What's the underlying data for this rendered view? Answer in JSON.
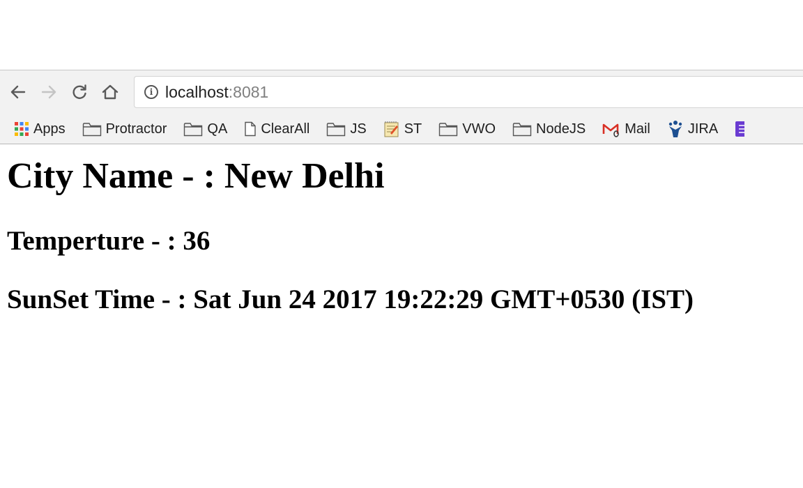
{
  "browser": {
    "url_host": "localhost",
    "url_port": ":8081",
    "bookmarks": [
      {
        "label": "Apps",
        "icon": "apps-grid-icon"
      },
      {
        "label": "Protractor",
        "icon": "folder-icon"
      },
      {
        "label": "QA",
        "icon": "folder-icon"
      },
      {
        "label": "ClearAll",
        "icon": "page-icon"
      },
      {
        "label": "JS",
        "icon": "folder-icon"
      },
      {
        "label": "ST",
        "icon": "notepad-icon"
      },
      {
        "label": "VWO",
        "icon": "folder-icon"
      },
      {
        "label": "NodeJS",
        "icon": "folder-icon"
      },
      {
        "label": "Mail",
        "icon": "gmail-icon"
      },
      {
        "label": "JIRA",
        "icon": "jira-icon"
      }
    ]
  },
  "page": {
    "city_line": "City Name - : New Delhi",
    "temp_line": "Temperture - : 36",
    "sunset_line": "SunSet Time - : Sat Jun 24 2017 19:22:29 GMT+0530 (IST)"
  }
}
